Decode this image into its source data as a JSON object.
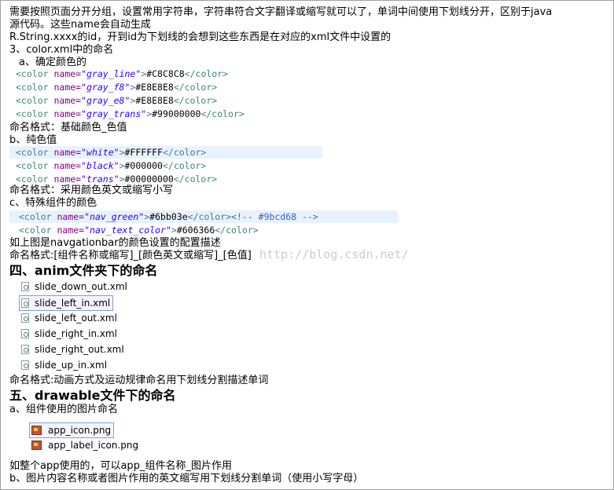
{
  "intro": {
    "line1": "需要按照页面分开分组，设置常用字符串，字符串符合文字翻译或缩写就可以了，单词中间使用下划线分开，区别于java",
    "line2": "源代码。这些name会自动生成",
    "line3": "R.String.xxxx的id，开到id为下划线的会想到这些东西是在对应的xml文件中设置的"
  },
  "section3": {
    "title": "3、color.xml中的命名",
    "sub_a": "a、确定颜色的",
    "colors_a": [
      {
        "name": "gray_line",
        "value": "#C8C8C8"
      },
      {
        "name": "gray_f8",
        "value": "#E8E8E8"
      },
      {
        "name": "gray_e8",
        "value": "#E8E8E8"
      },
      {
        "name": "gray_trans",
        "value": "#99000000"
      }
    ],
    "format_a": "命名格式：基础颜色_色值",
    "sub_b": "b、纯色值",
    "colors_b": [
      {
        "name": "white",
        "value": "#FFFFFF"
      },
      {
        "name": "black",
        "value": "#000000"
      },
      {
        "name": "trans",
        "value": "#00000000"
      }
    ],
    "format_b": "命名格式：采用颜色英文或缩写小写",
    "sub_c": "c、特殊组件的颜色",
    "colors_c": [
      {
        "name": "nav_green",
        "value": "#6bb03e",
        "comment": "<!-- #9bcd68 -->"
      },
      {
        "name": "nav_text_color",
        "value": "#606366",
        "comment": ""
      }
    ],
    "desc_c": "如上图是navgationbar的颜色设置的配置描述",
    "format_c": "命名格式:[组件名称或缩写]_[颜色英文或缩写]_[色值]"
  },
  "xml": {
    "open": "<color ",
    "attr": "name=",
    "close": "</color>"
  },
  "section4": {
    "title": "四、anim文件夹下的命名",
    "files": [
      "slide_down_out.xml",
      "slide_left_in.xml",
      "slide_left_out.xml",
      "slide_right_in.xml",
      "slide_right_out.xml",
      "slide_up_in.xml"
    ],
    "format": "命名格式:动画方式及运动规律命名用下划线分割描述单词"
  },
  "section5": {
    "title": "五、drawable文件下的命名",
    "sub_a": "a、组件使用的图片命名",
    "files": [
      "app_icon.png",
      "app_label_icon.png"
    ],
    "note": "如整个app使用的，可以app_组件名称_图片作用",
    "sub_b": "b、图片内容名称或者图片作用的英文缩写用下划线分割单词（使用小写字母）"
  },
  "watermark": "http://blog.csdn.net/"
}
